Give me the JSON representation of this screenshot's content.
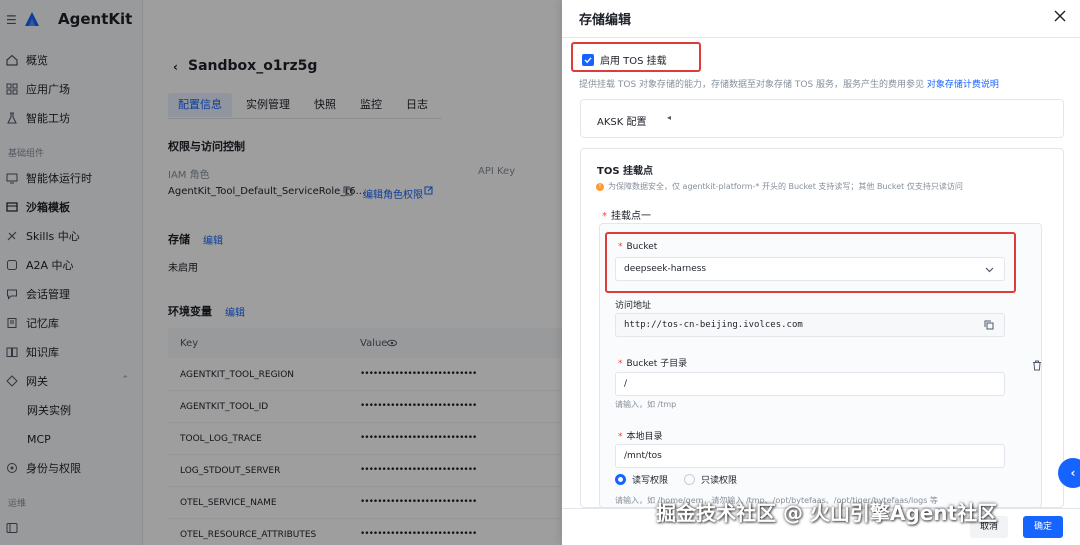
{
  "app": {
    "name": "AgentKit"
  },
  "sidebar": {
    "items": [
      {
        "label": "概览",
        "icon": "home-icon"
      },
      {
        "label": "应用广场",
        "icon": "grid-icon"
      },
      {
        "label": "智能工坊",
        "icon": "flask-icon"
      }
    ],
    "group_basic": "基础组件",
    "basic_items": [
      {
        "label": "智能体运行时",
        "icon": "runtime-icon"
      },
      {
        "label": "沙箱模板",
        "icon": "sandbox-icon"
      },
      {
        "label": "Skills 中心",
        "icon": "skills-icon"
      },
      {
        "label": "A2A 中心",
        "icon": "a2a-icon"
      },
      {
        "label": "会话管理",
        "icon": "chat-icon"
      },
      {
        "label": "记忆库",
        "icon": "memory-icon"
      },
      {
        "label": "知识库",
        "icon": "book-icon"
      },
      {
        "label": "网关",
        "icon": "gateway-icon"
      },
      {
        "label": "网关实例"
      },
      {
        "label": "MCP"
      },
      {
        "label": "身份与权限",
        "icon": "identity-icon"
      }
    ],
    "group_ops": "运维"
  },
  "main": {
    "title": "Sandbox_o1rz5g",
    "tabs": [
      "配置信息",
      "实例管理",
      "快照",
      "监控",
      "日志"
    ],
    "access_section": "权限与访问控制",
    "iam_label": "IAM 角色",
    "iam_value": "AgentKit_Tool_Default_ServiceRole_t6...",
    "iam_edit": "编辑角色权限",
    "apikey_label": "API Key",
    "storage_section": "存储",
    "storage_edit": "编辑",
    "storage_value": "未启用",
    "env_section": "环境变量",
    "env_edit": "编辑",
    "env_key_header": "Key",
    "env_value_header": "Value",
    "env_rows": [
      {
        "key": "AGENTKIT_TOOL_REGION",
        "value": "•••••••••••••••••••••••••••"
      },
      {
        "key": "AGENTKIT_TOOL_ID",
        "value": "•••••••••••••••••••••••••••"
      },
      {
        "key": "TOOL_LOG_TRACE",
        "value": "•••••••••••••••••••••••••••"
      },
      {
        "key": "LOG_STDOUT_SERVER",
        "value": "•••••••••••••••••••••••••••"
      },
      {
        "key": "OTEL_SERVICE_NAME",
        "value": "•••••••••••••••••••••••••••"
      },
      {
        "key": "OTEL_RESOURCE_ATTRIBUTES",
        "value": "•••••••••••••••••••••••••••"
      }
    ]
  },
  "drawer": {
    "title": "存储编辑",
    "enable_tos_label": "启用 TOS 挂载",
    "description": "提供挂载 TOS 对象存储的能力，存储数据至对象存储 TOS 服务，服务产生的费用参见",
    "description_link": "对象存储计费说明",
    "aksk_label": "AKSK 配置",
    "mount_section": "TOS 挂载点",
    "notice": "为保障数据安全，仅 agentkit-platform-* 开头的 Bucket 支持读写；其他 Bucket 仅支持只读访问",
    "mount_one": "挂载点一",
    "bucket_label": "Bucket",
    "bucket_value": "deepseek-harness",
    "access_addr_label": "访问地址",
    "access_addr_value": "http://tos-cn-beijing.ivolces.com",
    "subdir_label": "Bucket 子目录",
    "subdir_value": "/",
    "subdir_hint": "请输入，如 /tmp",
    "local_dir_label": "本地目录",
    "local_dir_value": "/mnt/tos",
    "rw_label": "读写权限",
    "ro_label": "只读权限",
    "local_hint": "请输入，如 /home/gem，请勿输入 /tmp、/opt/bytefaas、/opt/tiger/bytefaas/logs 等",
    "cancel": "取消",
    "confirm": "确定"
  },
  "watermark": "掘金技术社区 @ 火山引擎Agent社区",
  "colors": {
    "accent": "#1664ff",
    "highlight": "#e03b3b"
  }
}
